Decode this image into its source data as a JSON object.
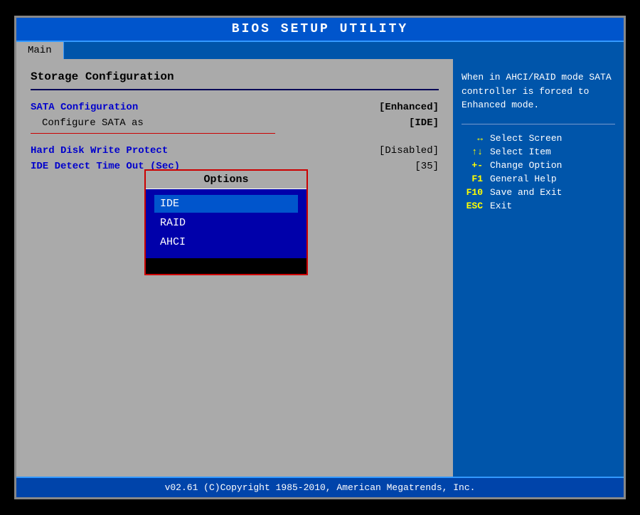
{
  "title": "BIOS SETUP UTILITY",
  "tabs": [
    {
      "label": "Main",
      "active": true
    }
  ],
  "left": {
    "section_title": "Storage Configuration",
    "items_group1": [
      {
        "label": "SATA Configuration",
        "is_sub": false,
        "value": "[Enhanced]"
      },
      {
        "label": "Configure SATA as",
        "is_sub": true,
        "value": "[IDE]"
      }
    ],
    "items_group2": [
      {
        "label": "Hard Disk Write Protect",
        "value": "[Disabled]"
      },
      {
        "label": "IDE Detect Time Out (Sec)",
        "value": "[35]"
      }
    ],
    "options_popup": {
      "title": "Options",
      "items": [
        {
          "label": "IDE",
          "selected": true
        },
        {
          "label": "RAID",
          "selected": false
        },
        {
          "label": "AHCI",
          "selected": false
        }
      ]
    }
  },
  "right": {
    "help_text": "When in AHCI/RAID mode SATA controller is forced to Enhanced mode.",
    "keys": [
      {
        "sym": "↔",
        "desc": "Select Screen"
      },
      {
        "sym": "↑↓",
        "desc": "Select Item"
      },
      {
        "sym": "+-",
        "desc": "Change Option"
      },
      {
        "sym": "F1",
        "desc": "General Help"
      },
      {
        "sym": "F10",
        "desc": "Save and Exit"
      },
      {
        "sym": "ESC",
        "desc": "Exit"
      }
    ]
  },
  "footer": "v02.61  (C)Copyright 1985-2010, American Megatrends, Inc."
}
